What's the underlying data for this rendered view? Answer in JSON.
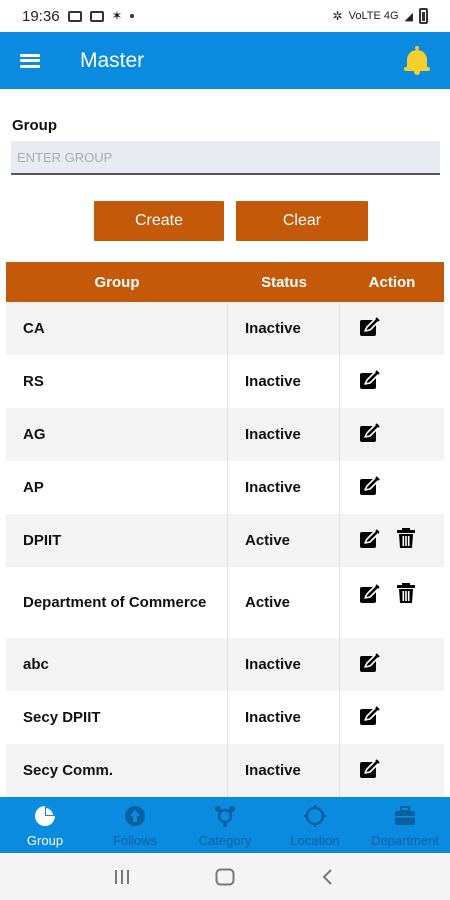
{
  "status_bar": {
    "time": "19:36",
    "network_text": "VoLTE 4G"
  },
  "appbar": {
    "title": "Master",
    "menu_icon": "hamburger-menu-icon",
    "notification_icon": "bell-icon"
  },
  "form": {
    "label": "Group",
    "input_placeholder": "ENTER GROUP",
    "input_value": "",
    "create_label": "Create",
    "clear_label": "Clear"
  },
  "table": {
    "headers": {
      "group": "Group",
      "status": "Status",
      "action": "Action"
    },
    "rows": [
      {
        "group": "CA",
        "status": "Inactive",
        "actions": [
          "edit"
        ]
      },
      {
        "group": "RS",
        "status": "Inactive",
        "actions": [
          "edit"
        ]
      },
      {
        "group": "AG",
        "status": "Inactive",
        "actions": [
          "edit"
        ]
      },
      {
        "group": "AP",
        "status": "Inactive",
        "actions": [
          "edit"
        ]
      },
      {
        "group": "DPIIT",
        "status": "Active",
        "actions": [
          "edit",
          "delete"
        ]
      },
      {
        "group": "Department of Commerce",
        "status": "Active",
        "actions": [
          "edit",
          "delete"
        ]
      },
      {
        "group": "abc",
        "status": "Inactive",
        "actions": [
          "edit"
        ]
      },
      {
        "group": "Secy DPIIT",
        "status": "Inactive",
        "actions": [
          "edit"
        ]
      },
      {
        "group": "Secy Comm.",
        "status": "Inactive",
        "actions": [
          "edit"
        ]
      }
    ]
  },
  "bottom_nav": {
    "items": [
      {
        "label": "Group",
        "icon": "pie-chart-icon",
        "active": true
      },
      {
        "label": "Follows",
        "icon": "arrow-up-circle-icon",
        "active": false
      },
      {
        "label": "Category",
        "icon": "category-icon",
        "active": false
      },
      {
        "label": "Location",
        "icon": "location-icon",
        "active": false
      },
      {
        "label": "Department",
        "icon": "briefcase-icon",
        "active": false
      }
    ]
  },
  "colors": {
    "primary": "#0b8be0",
    "accent": "#c4590a",
    "bell": "#f5d02a",
    "nav_inactive": "#0a5fa0"
  }
}
